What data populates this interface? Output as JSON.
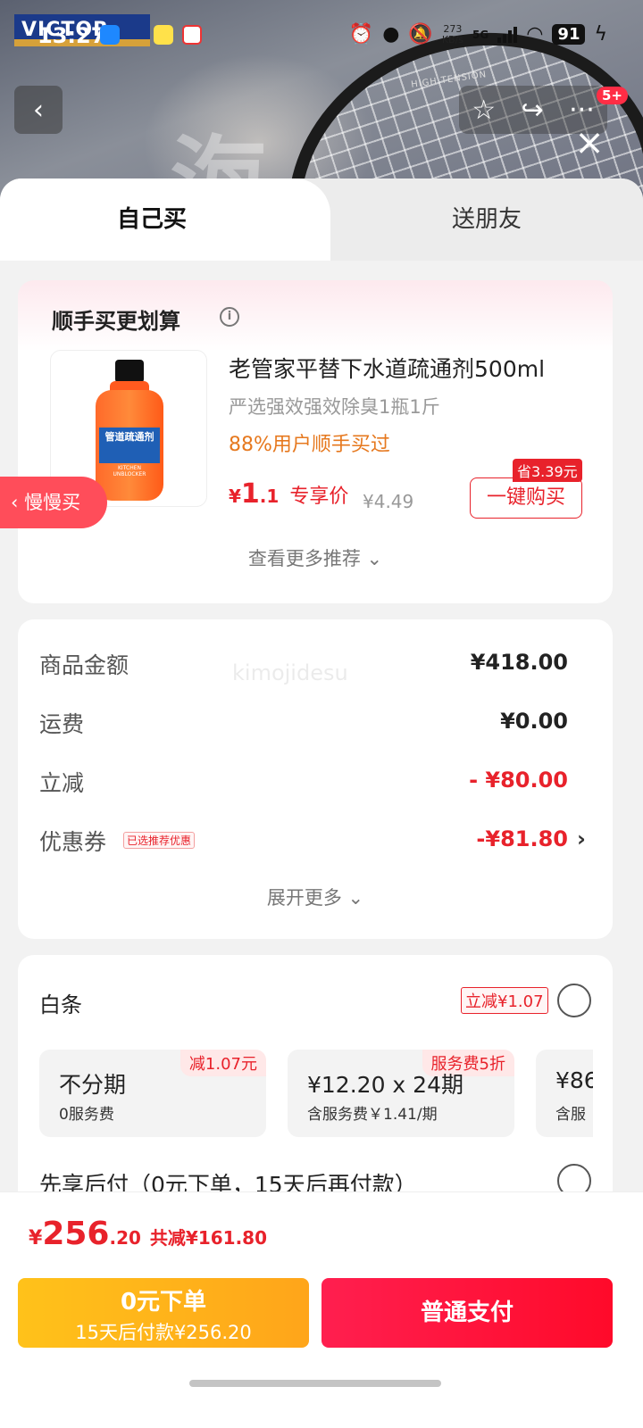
{
  "status_bar": {
    "time": "13:27",
    "net_speed_value": "273",
    "net_speed_unit": "KB/s",
    "network": "5G",
    "battery": "91"
  },
  "banner": {
    "brand": "VICTOR",
    "racket_brand": "HIGH TENSION",
    "brush_char": "海"
  },
  "header": {
    "notification_badge": "5+"
  },
  "tabs": [
    {
      "label": "自己买",
      "active": true
    },
    {
      "label": "送朋友",
      "active": false
    }
  ],
  "addon": {
    "title": "顺手买更划算",
    "info_symbol": "i",
    "product": {
      "name": "老管家平替下水道疏通剂500ml",
      "desc": "严选强效强效除臭1瓶1斤",
      "buyers": "88%用户顺手买过",
      "price_currency": "¥",
      "price_int": "1",
      "price_dec": ".1",
      "price_label": "专享价",
      "orig_price": "¥4.49",
      "save_tag": "省3.39元",
      "buy_label": "一键购买",
      "bottle_text": "管道疏通剂",
      "bottle_sub": "KITCHEN UNBLOCKER"
    },
    "more_label": "查看更多推荐"
  },
  "slow_buy": "慢慢买",
  "summary": {
    "watermark": "kimojidesu",
    "rows": [
      {
        "label": "商品金额",
        "value": "¥418.00"
      },
      {
        "label": "运费",
        "value": "¥0.00"
      },
      {
        "label": "立减",
        "value": "- ¥80.00"
      },
      {
        "label": "优惠券",
        "value": "-¥81.80",
        "tag": "已选推荐优惠"
      }
    ],
    "expand_label": "展开更多"
  },
  "payment": {
    "baitiao_label": "白条",
    "baitiao_tag": "立减¥1.07",
    "plans": [
      {
        "tag": "减1.07元",
        "main": "不分期",
        "sub": "0服务费"
      },
      {
        "tag": "服务费5折",
        "main": "¥12.20 x 24期",
        "sub": "含服务费￥1.41/期"
      },
      {
        "tag": "",
        "main": "¥86",
        "sub": "含服"
      }
    ],
    "bnpl_label": "先享后付（0元下单，15天后再付款）"
  },
  "bottom": {
    "currency": "¥",
    "total_int": "256",
    "total_dec": ".20",
    "saved": "共减¥161.80",
    "pay_later_main": "0元下单",
    "pay_later_sub": "15天后付款¥256.20",
    "pay_normal": "普通支付"
  },
  "colors": {
    "accent_red": "#e8222b",
    "orange_text": "#e6781e",
    "pay_later_yellow": "#ffb31a"
  }
}
